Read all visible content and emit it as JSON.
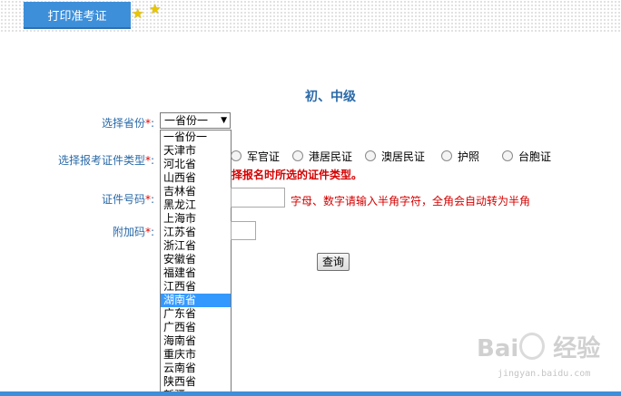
{
  "header": {
    "tab_label": "打印准考证"
  },
  "form": {
    "level_title": "初、中级",
    "province_label": "选择省份",
    "province_selected": "一省份一",
    "id_type_label": "选择报考证件类型",
    "id_type_options": [
      "军官证",
      "港居民证",
      "澳居民证",
      "护照",
      "台胞证"
    ],
    "id_type_hint": "择报名时所选的证件类型。",
    "id_number_label": "证件号码",
    "id_number_hint": "字母、数字请输入半角字符，全角会自动转为半角",
    "extra_code_label": "附加码",
    "required_mark": "*",
    "colon": ":",
    "query_button": "查询"
  },
  "province_dropdown": {
    "options": [
      "一省份一",
      "天津市",
      "河北省",
      "山西省",
      "吉林省",
      "黑龙江",
      "上海市",
      "江苏省",
      "浙江省",
      "安徽省",
      "福建省",
      "江西省",
      "湖南省",
      "广东省",
      "广西省",
      "海南省",
      "重庆市",
      "云南省",
      "陕西省",
      "新疆"
    ],
    "highlighted": "湖南省"
  },
  "watermark": {
    "brand": "Bai",
    "brand2": "经验",
    "url": "jingyan.baidu.com"
  },
  "colors": {
    "accent": "#3d8fd9",
    "label": "#2a6aa8",
    "required": "#e00000",
    "highlight": "#3399ff"
  }
}
